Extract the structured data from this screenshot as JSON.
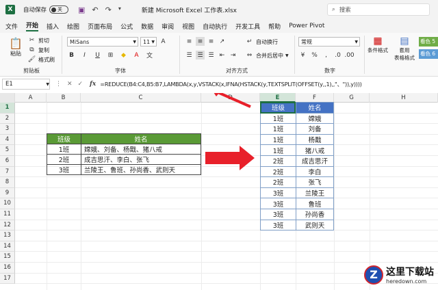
{
  "titlebar": {
    "app_icon": "X",
    "autosave_label": "自动保存",
    "autosave_state": "关",
    "doc_title": "新建 Microsoft Excel 工作表.xlsx",
    "search_placeholder": "搜索"
  },
  "menu": [
    "文件",
    "开始",
    "插入",
    "绘图",
    "页面布局",
    "公式",
    "数据",
    "审阅",
    "视图",
    "自动执行",
    "开发工具",
    "帮助",
    "Power Pivot"
  ],
  "ribbon": {
    "clipboard": {
      "paste": "粘贴",
      "cut": "剪切",
      "copy": "复制",
      "painter": "格式刷",
      "label": "剪贴板"
    },
    "font": {
      "name": "MiSans",
      "size": "11",
      "label": "字体"
    },
    "align": {
      "wrap": "自动换行",
      "merge": "合并后居中",
      "label": "对齐方式"
    },
    "number": {
      "format": "常规",
      "label": "数字"
    },
    "styles": {
      "cond": "条件格式",
      "table": "套用",
      "table2": "表格格式",
      "s1": "看色 5",
      "s2": "看色 6"
    }
  },
  "formulabar": {
    "namebox": "E1",
    "fx": "fx",
    "formula": "=REDUCE(B4:C4,B5:B7,LAMBDA(x,y,VSTACK(x,IFNA(HSTACK(y,TEXTSPLIT(OFFSET(y,,1),,\"、\")),y))))"
  },
  "columns": [
    "A",
    "B",
    "C",
    "D",
    "E",
    "F",
    "G",
    "H"
  ],
  "rows": [
    "1",
    "2",
    "3",
    "4",
    "5",
    "6",
    "7",
    "8",
    "9",
    "10",
    "11",
    "12",
    "13",
    "14",
    "15",
    "16",
    "17"
  ],
  "source_table": {
    "headers": [
      "班级",
      "姓名"
    ],
    "rows": [
      [
        "1班",
        "嫦娥、刘备、杨戬、猪八戒"
      ],
      [
        "2班",
        "成吉思汗、李白、张飞"
      ],
      [
        "3班",
        "兰陵王、鲁班、孙尚香、武则天"
      ]
    ]
  },
  "result_table": {
    "headers": [
      "班级",
      "姓名"
    ],
    "rows": [
      [
        "1班",
        "嫦娥"
      ],
      [
        "1班",
        "刘备"
      ],
      [
        "1班",
        "杨戬"
      ],
      [
        "1班",
        "猪八戒"
      ],
      [
        "2班",
        "成吉思汗"
      ],
      [
        "2班",
        "李白"
      ],
      [
        "2班",
        "张飞"
      ],
      [
        "3班",
        "兰陵王"
      ],
      [
        "3班",
        "鲁班"
      ],
      [
        "3班",
        "孙尚香"
      ],
      [
        "3班",
        "武则天"
      ]
    ]
  },
  "watermark": {
    "logo": "Z",
    "cn": "这里下载站",
    "en": "heredown.com"
  },
  "colors": {
    "excel_green": "#1d6f42",
    "header_green": "#5a9a36",
    "header_blue": "#4472c4",
    "arrow_red": "#e8202a"
  }
}
